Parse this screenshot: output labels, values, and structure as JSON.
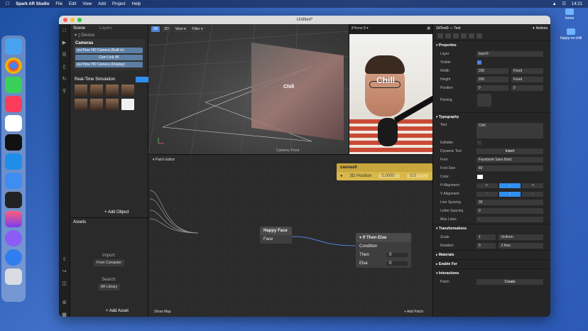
{
  "menubar": {
    "app_name": "Spark AR Studio",
    "menus": [
      "File",
      "Edit",
      "View",
      "Add",
      "Project",
      "Help"
    ],
    "time": "14:21"
  },
  "desktop": {
    "icons": [
      {
        "label": "home"
      },
      {
        "label": "happy-vs-chill"
      }
    ]
  },
  "window": {
    "title": "Untitled*"
  },
  "scene": {
    "tabs": [
      "Scene",
      "Layers"
    ],
    "device_label": "Device",
    "cameras_header": "Cameras",
    "cameras": [
      "aceTime HD Camera (Built-in)",
      "Cam Link 4K",
      "aceTime HD Camera (Display)"
    ],
    "simulation_header": "Real-Time Simulation",
    "add_object_label": "+ Add Object"
  },
  "assets": {
    "header": "Assets",
    "import_label": "Import:",
    "from_computer_label": "From Computer",
    "search_label": "Search:",
    "ar_library_label": "AR Library",
    "add_asset_label": "+ Add Asset"
  },
  "viewport": {
    "mode_3d": "3D",
    "mode_2d": "2D",
    "view_label": "View",
    "filter_label": "Filter",
    "chill_text": "Chill",
    "camera_caption": "Camera: Front"
  },
  "simulator": {
    "device": "iPhone 8",
    "chill_text": "Chill"
  },
  "patch_editor": {
    "title": "Patch Editor",
    "show_map_label": "Show Map",
    "add_patch_label": "+ Add Patch",
    "canvas_node": {
      "title": "canvas0",
      "port": "3D Position",
      "value1": "0.0000",
      "value2": "0.0"
    },
    "happy_face_node": {
      "title": "Happy Face",
      "port": "Face"
    },
    "if_then_else_node": {
      "title": "If Then Else",
      "rows": [
        {
          "label": "Condition",
          "value": ""
        },
        {
          "label": "Then",
          "value": "0"
        },
        {
          "label": "Else",
          "value": "0"
        }
      ]
    }
  },
  "inspector": {
    "object_name": "2dText0",
    "object_type": "Text",
    "actions_label": "Actions",
    "properties_header": "Properties",
    "layer_label": "Layer",
    "layer_value": "layer0",
    "visible_label": "Visible",
    "width_label": "Width",
    "width_value": "200",
    "width_mode": "Fixed",
    "height_label": "Height",
    "height_value": "200",
    "height_mode": "Fixed",
    "position_label": "Position",
    "position_x": "0",
    "position_y": "0",
    "pinning_label": "Pinning",
    "typography_header": "Typography",
    "text_label": "Text",
    "text_value": "Chill",
    "editable_label": "Editable",
    "dynamic_text_label": "Dynamic Text",
    "insert_label": "Insert",
    "font_label": "Font",
    "font_value": "Facebook Sans Bold",
    "font_size_label": "Font Size",
    "font_size_value": "60",
    "color_label": "Color",
    "h_alignment_label": "H Alignment",
    "v_alignment_label": "V Alignment",
    "line_spacing_label": "Line Spacing",
    "line_spacing_value": "30",
    "letter_spacing_label": "Letter Spacing",
    "letter_spacing_value": "0",
    "max_lines_label": "Max Lines",
    "max_lines_value": "-",
    "transformations_header": "Transformations",
    "scale_label": "Scale",
    "scale_value": "1",
    "scale_mode": "Uniform",
    "rotation_label": "Rotation",
    "rotation_value": "0",
    "rotation_axis": "Z Axis",
    "materials_header": "Materials",
    "enable_for_header": "Enable For",
    "interactions_header": "Interactions",
    "patch_label": "Patch",
    "create_label": "Create"
  },
  "colors": {
    "accent": "#4f82d9",
    "node_yellow": "#d8b84a",
    "selection_blue": "#2f8ff0"
  }
}
